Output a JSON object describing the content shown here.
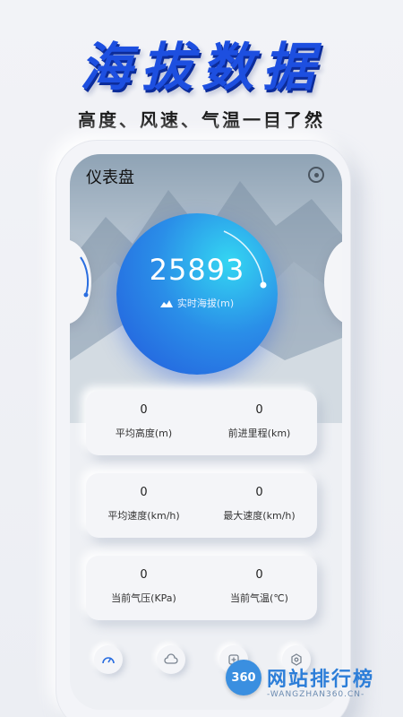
{
  "promo": {
    "headline": "海拔数据",
    "subline": "高度、风速、气温一目了然"
  },
  "app": {
    "title": "仪表盘",
    "gauge": {
      "value": "25893",
      "label": "实时海拔(m)"
    },
    "cards": [
      {
        "left": {
          "value": "0",
          "label": "平均高度(m)"
        },
        "right": {
          "value": "0",
          "label": "前进里程(km)"
        }
      },
      {
        "left": {
          "value": "0",
          "label": "平均速度(km/h)"
        },
        "right": {
          "value": "0",
          "label": "最大速度(km/h)"
        }
      },
      {
        "left": {
          "value": "0",
          "label": "当前气压(KPa)"
        },
        "right": {
          "value": "0",
          "label": "当前气温(℃)"
        }
      }
    ],
    "nav_icons": [
      "speedometer-icon",
      "cloud-icon",
      "plus-box-icon",
      "hexagon-icon"
    ]
  },
  "watermark": {
    "logo": "360",
    "name": "网站排行榜",
    "url": "-WANGZHAN360.CN-"
  },
  "colors": {
    "headline": "#1d4fe0",
    "gauge_start": "#34d6f2",
    "gauge_end": "#2358dc"
  }
}
